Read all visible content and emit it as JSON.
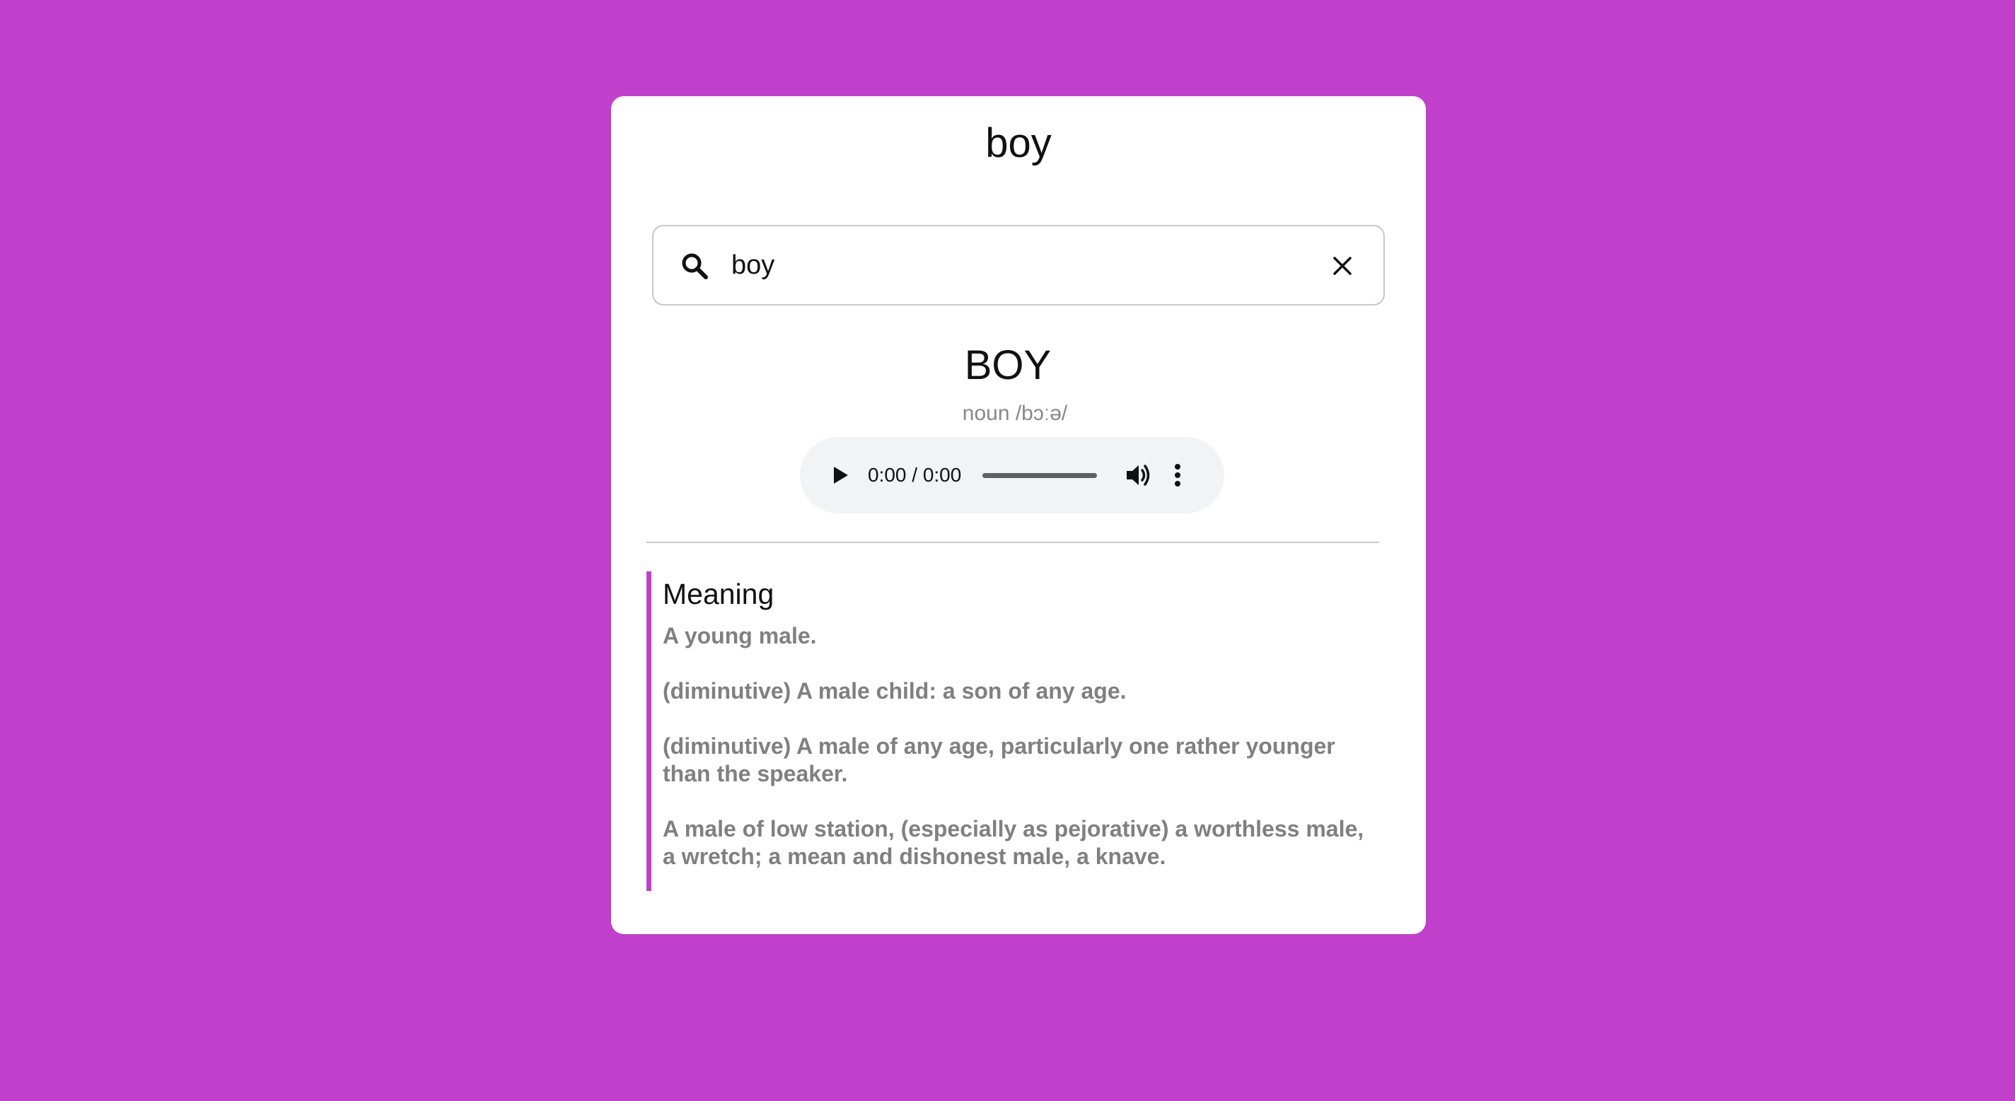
{
  "app": {
    "title": "boy"
  },
  "search": {
    "value": "boy",
    "icon": "search-icon",
    "clear_icon": "close-icon"
  },
  "word": {
    "heading": "BOY",
    "phonetic": "noun /bɔːə/"
  },
  "audio": {
    "time": "0:00 / 0:00",
    "progress": 0,
    "icons": [
      "play-icon",
      "volume-icon",
      "more-vertical-icon"
    ]
  },
  "meaning": {
    "title": "Meaning",
    "definitions": [
      "A young male.",
      "(diminutive) A male child: a son of any age.",
      "(diminutive) A male of any age, particularly one rather younger than the speaker.",
      "A male of low station, (especially as pejorative) a worthless male, a wretch; a mean and dishonest male, a knave."
    ]
  },
  "colors": {
    "background": "#c040cc",
    "card": "#ffffff",
    "accent": "#c040cc",
    "definition_text": "#808080"
  }
}
